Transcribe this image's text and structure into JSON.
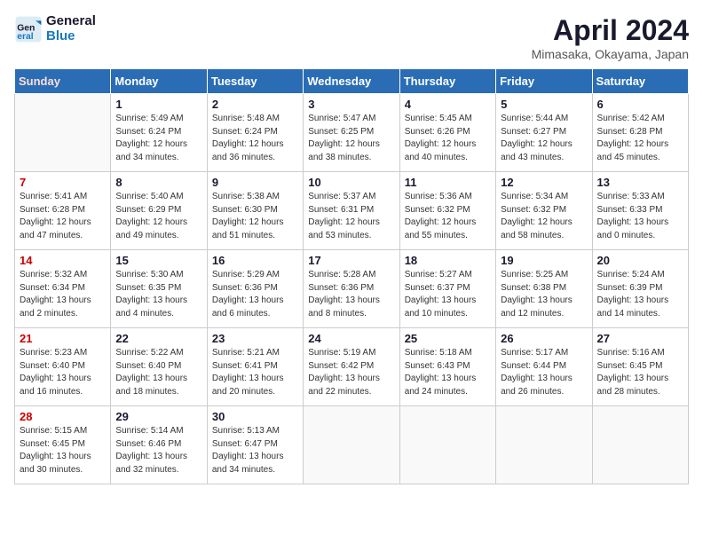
{
  "header": {
    "logo_line1": "General",
    "logo_line2": "Blue",
    "title": "April 2024",
    "location": "Mimasaka, Okayama, Japan"
  },
  "weekdays": [
    "Sunday",
    "Monday",
    "Tuesday",
    "Wednesday",
    "Thursday",
    "Friday",
    "Saturday"
  ],
  "weeks": [
    [
      {
        "day": "",
        "info": ""
      },
      {
        "day": "1",
        "info": "Sunrise: 5:49 AM\nSunset: 6:24 PM\nDaylight: 12 hours\nand 34 minutes."
      },
      {
        "day": "2",
        "info": "Sunrise: 5:48 AM\nSunset: 6:24 PM\nDaylight: 12 hours\nand 36 minutes."
      },
      {
        "day": "3",
        "info": "Sunrise: 5:47 AM\nSunset: 6:25 PM\nDaylight: 12 hours\nand 38 minutes."
      },
      {
        "day": "4",
        "info": "Sunrise: 5:45 AM\nSunset: 6:26 PM\nDaylight: 12 hours\nand 40 minutes."
      },
      {
        "day": "5",
        "info": "Sunrise: 5:44 AM\nSunset: 6:27 PM\nDaylight: 12 hours\nand 43 minutes."
      },
      {
        "day": "6",
        "info": "Sunrise: 5:42 AM\nSunset: 6:28 PM\nDaylight: 12 hours\nand 45 minutes."
      }
    ],
    [
      {
        "day": "7",
        "info": "Sunrise: 5:41 AM\nSunset: 6:28 PM\nDaylight: 12 hours\nand 47 minutes."
      },
      {
        "day": "8",
        "info": "Sunrise: 5:40 AM\nSunset: 6:29 PM\nDaylight: 12 hours\nand 49 minutes."
      },
      {
        "day": "9",
        "info": "Sunrise: 5:38 AM\nSunset: 6:30 PM\nDaylight: 12 hours\nand 51 minutes."
      },
      {
        "day": "10",
        "info": "Sunrise: 5:37 AM\nSunset: 6:31 PM\nDaylight: 12 hours\nand 53 minutes."
      },
      {
        "day": "11",
        "info": "Sunrise: 5:36 AM\nSunset: 6:32 PM\nDaylight: 12 hours\nand 55 minutes."
      },
      {
        "day": "12",
        "info": "Sunrise: 5:34 AM\nSunset: 6:32 PM\nDaylight: 12 hours\nand 58 minutes."
      },
      {
        "day": "13",
        "info": "Sunrise: 5:33 AM\nSunset: 6:33 PM\nDaylight: 13 hours\nand 0 minutes."
      }
    ],
    [
      {
        "day": "14",
        "info": "Sunrise: 5:32 AM\nSunset: 6:34 PM\nDaylight: 13 hours\nand 2 minutes."
      },
      {
        "day": "15",
        "info": "Sunrise: 5:30 AM\nSunset: 6:35 PM\nDaylight: 13 hours\nand 4 minutes."
      },
      {
        "day": "16",
        "info": "Sunrise: 5:29 AM\nSunset: 6:36 PM\nDaylight: 13 hours\nand 6 minutes."
      },
      {
        "day": "17",
        "info": "Sunrise: 5:28 AM\nSunset: 6:36 PM\nDaylight: 13 hours\nand 8 minutes."
      },
      {
        "day": "18",
        "info": "Sunrise: 5:27 AM\nSunset: 6:37 PM\nDaylight: 13 hours\nand 10 minutes."
      },
      {
        "day": "19",
        "info": "Sunrise: 5:25 AM\nSunset: 6:38 PM\nDaylight: 13 hours\nand 12 minutes."
      },
      {
        "day": "20",
        "info": "Sunrise: 5:24 AM\nSunset: 6:39 PM\nDaylight: 13 hours\nand 14 minutes."
      }
    ],
    [
      {
        "day": "21",
        "info": "Sunrise: 5:23 AM\nSunset: 6:40 PM\nDaylight: 13 hours\nand 16 minutes."
      },
      {
        "day": "22",
        "info": "Sunrise: 5:22 AM\nSunset: 6:40 PM\nDaylight: 13 hours\nand 18 minutes."
      },
      {
        "day": "23",
        "info": "Sunrise: 5:21 AM\nSunset: 6:41 PM\nDaylight: 13 hours\nand 20 minutes."
      },
      {
        "day": "24",
        "info": "Sunrise: 5:19 AM\nSunset: 6:42 PM\nDaylight: 13 hours\nand 22 minutes."
      },
      {
        "day": "25",
        "info": "Sunrise: 5:18 AM\nSunset: 6:43 PM\nDaylight: 13 hours\nand 24 minutes."
      },
      {
        "day": "26",
        "info": "Sunrise: 5:17 AM\nSunset: 6:44 PM\nDaylight: 13 hours\nand 26 minutes."
      },
      {
        "day": "27",
        "info": "Sunrise: 5:16 AM\nSunset: 6:45 PM\nDaylight: 13 hours\nand 28 minutes."
      }
    ],
    [
      {
        "day": "28",
        "info": "Sunrise: 5:15 AM\nSunset: 6:45 PM\nDaylight: 13 hours\nand 30 minutes."
      },
      {
        "day": "29",
        "info": "Sunrise: 5:14 AM\nSunset: 6:46 PM\nDaylight: 13 hours\nand 32 minutes."
      },
      {
        "day": "30",
        "info": "Sunrise: 5:13 AM\nSunset: 6:47 PM\nDaylight: 13 hours\nand 34 minutes."
      },
      {
        "day": "",
        "info": ""
      },
      {
        "day": "",
        "info": ""
      },
      {
        "day": "",
        "info": ""
      },
      {
        "day": "",
        "info": ""
      }
    ]
  ]
}
